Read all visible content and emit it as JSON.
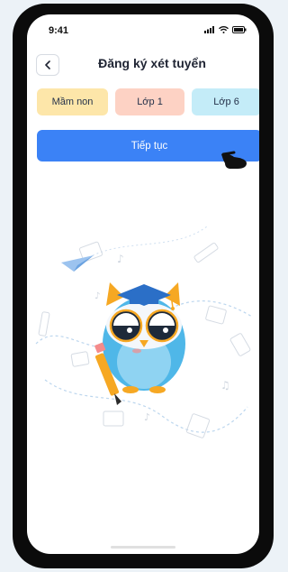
{
  "status_bar": {
    "time": "9:41"
  },
  "header": {
    "title": "Đăng ký xét tuyển"
  },
  "chips": [
    {
      "label": "Mầm non",
      "bg": "#fde6a9"
    },
    {
      "label": "Lớp 1",
      "bg": "#fdd2c4"
    },
    {
      "label": "Lớp 6",
      "bg": "#c4ecf8"
    }
  ],
  "primary_action": {
    "label": "Tiếp tục",
    "bg": "#3b82f6"
  },
  "colors": {
    "background": "#ecf2f7",
    "owl_body": "#4fb7e8",
    "owl_ears": "#f6a823",
    "cap": "#2b6fc7"
  },
  "icons": {
    "back": "chevron-left-icon",
    "signal": "signal-icon",
    "wifi": "wifi-icon",
    "battery": "battery-icon",
    "cursor": "hand-pointer-icon"
  }
}
